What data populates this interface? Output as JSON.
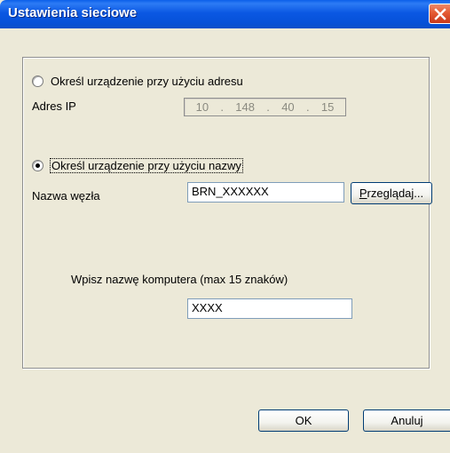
{
  "window": {
    "title": "Ustawienia sieciowe"
  },
  "options": {
    "by_address_label": "Określ urządzenie przy użyciu adresu",
    "by_address_checked": false,
    "ip_label": "Adres IP",
    "ip_octets": [
      "10",
      "148",
      "40",
      "15"
    ],
    "ip_separator": ".",
    "by_name_label": "Określ urządzenie przy użyciu nazwy",
    "by_name_checked": true,
    "node_name_label": "Nazwa węzła",
    "node_name_value": "BRN_XXXXXX",
    "browse_label_underlined": "P",
    "browse_label_rest": "rzeglądaj...",
    "computer_name_label": "Wpisz nazwę komputera (max 15 znaków)",
    "computer_name_value": "XXXX"
  },
  "buttons": {
    "ok_label": "OK",
    "cancel_label": "Anuluj"
  },
  "icons": {
    "close": "close-icon"
  }
}
